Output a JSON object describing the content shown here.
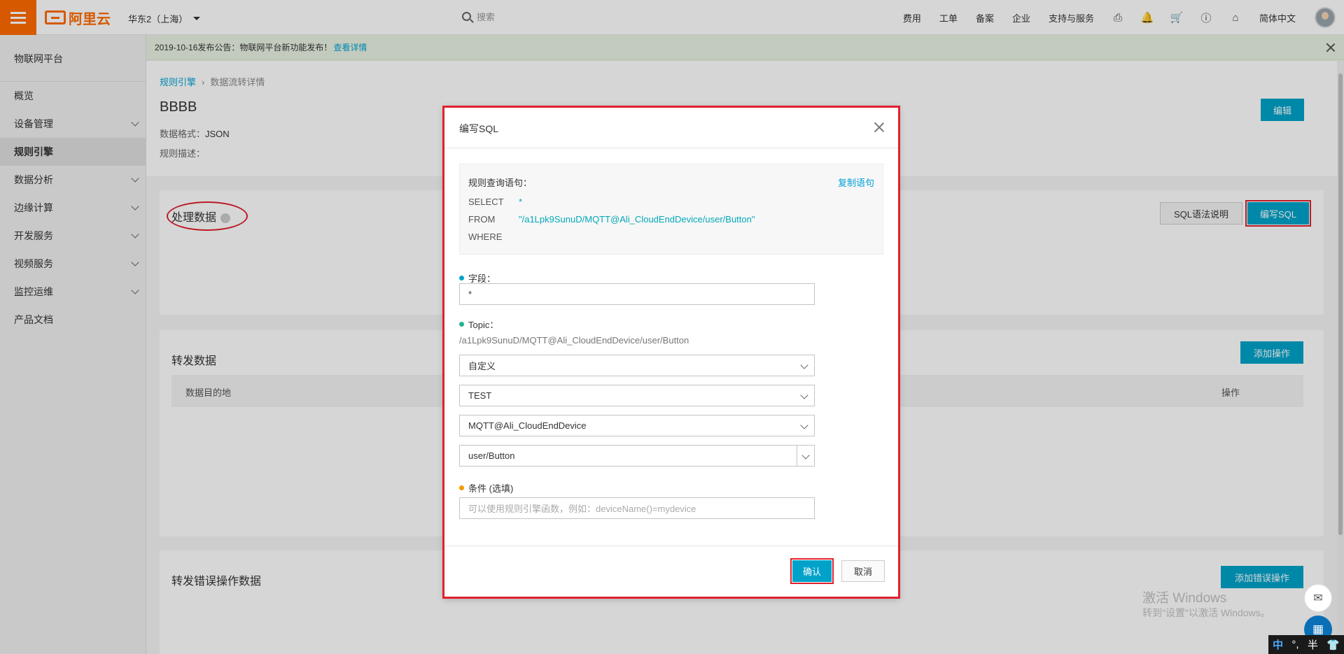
{
  "topbar": {
    "logo_text": "阿里云",
    "region": "华东2（上海）",
    "search_placeholder": "搜索",
    "nav": [
      "费用",
      "工单",
      "备案",
      "企业",
      "支持与服务"
    ],
    "language": "简体中文",
    "icons": [
      "terminal-icon",
      "bell-icon",
      "cart-icon",
      "help-icon",
      "home-icon"
    ]
  },
  "sidebar": {
    "title": "物联网平台",
    "items": [
      {
        "label": "概览",
        "has_children": false
      },
      {
        "label": "设备管理",
        "has_children": true
      },
      {
        "label": "规则引擎",
        "has_children": false,
        "active": true
      },
      {
        "label": "数据分析",
        "has_children": true
      },
      {
        "label": "边缘计算",
        "has_children": true
      },
      {
        "label": "开发服务",
        "has_children": true
      },
      {
        "label": "视频服务",
        "has_children": true
      },
      {
        "label": "监控运维",
        "has_children": true
      },
      {
        "label": "产品文档",
        "has_children": false
      }
    ]
  },
  "notice": {
    "text": "2019-10-16发布公告：物联网平台新功能发布！",
    "link": "查看详情"
  },
  "page": {
    "breadcrumb": [
      "规则引擎",
      "数据流转详情"
    ],
    "title": "BBBB",
    "format_label": "数据格式：",
    "format_value": "JSON",
    "desc_label": "规则描述：",
    "edit_button": "编辑",
    "process_section": "处理数据",
    "sql_help_button": "SQL语法说明",
    "write_sql_button": "编写SQL",
    "forward_section": "转发数据",
    "add_action_button": "添加操作",
    "table_col_dest": "数据目的地",
    "table_col_action": "操作",
    "error_section": "转发错误操作数据",
    "add_error_button": "添加错误操作"
  },
  "modal": {
    "title": "编写SQL",
    "sql_label": "规则查询语句：",
    "copy_label": "复制语句",
    "select_kw": "SELECT",
    "select_val": "*",
    "from_kw": "FROM",
    "from_val": "\"/a1Lpk9SunuD/MQTT@Ali_CloudEndDevice/user/Button\"",
    "where_kw": "WHERE",
    "field_label": "字段：",
    "field_value": "*",
    "topic_label": "Topic：",
    "topic_path": "/a1Lpk9SunuD/MQTT@Ali_CloudEndDevice/user/Button",
    "topic_type": "自定义",
    "product": "TEST",
    "device": "MQTT@Ali_CloudEndDevice",
    "topic_suffix": "user/Button",
    "condition_label": "条件 (选填)",
    "condition_placeholder": "可以使用规则引擎函数，例如：deviceName()=mydevice",
    "confirm": "确认",
    "cancel": "取消"
  },
  "watermark": {
    "line1": "激活 Windows",
    "line2": "转到\"设置\"以激活 Windows。"
  },
  "tray": {
    "ime_mode": "中",
    "punct": "°,",
    "width_mode": "半"
  },
  "colors": {
    "brand": "#ff6a00",
    "primary": "#00a2ca",
    "highlight": "#e0222d",
    "link": "#00a1d6"
  }
}
